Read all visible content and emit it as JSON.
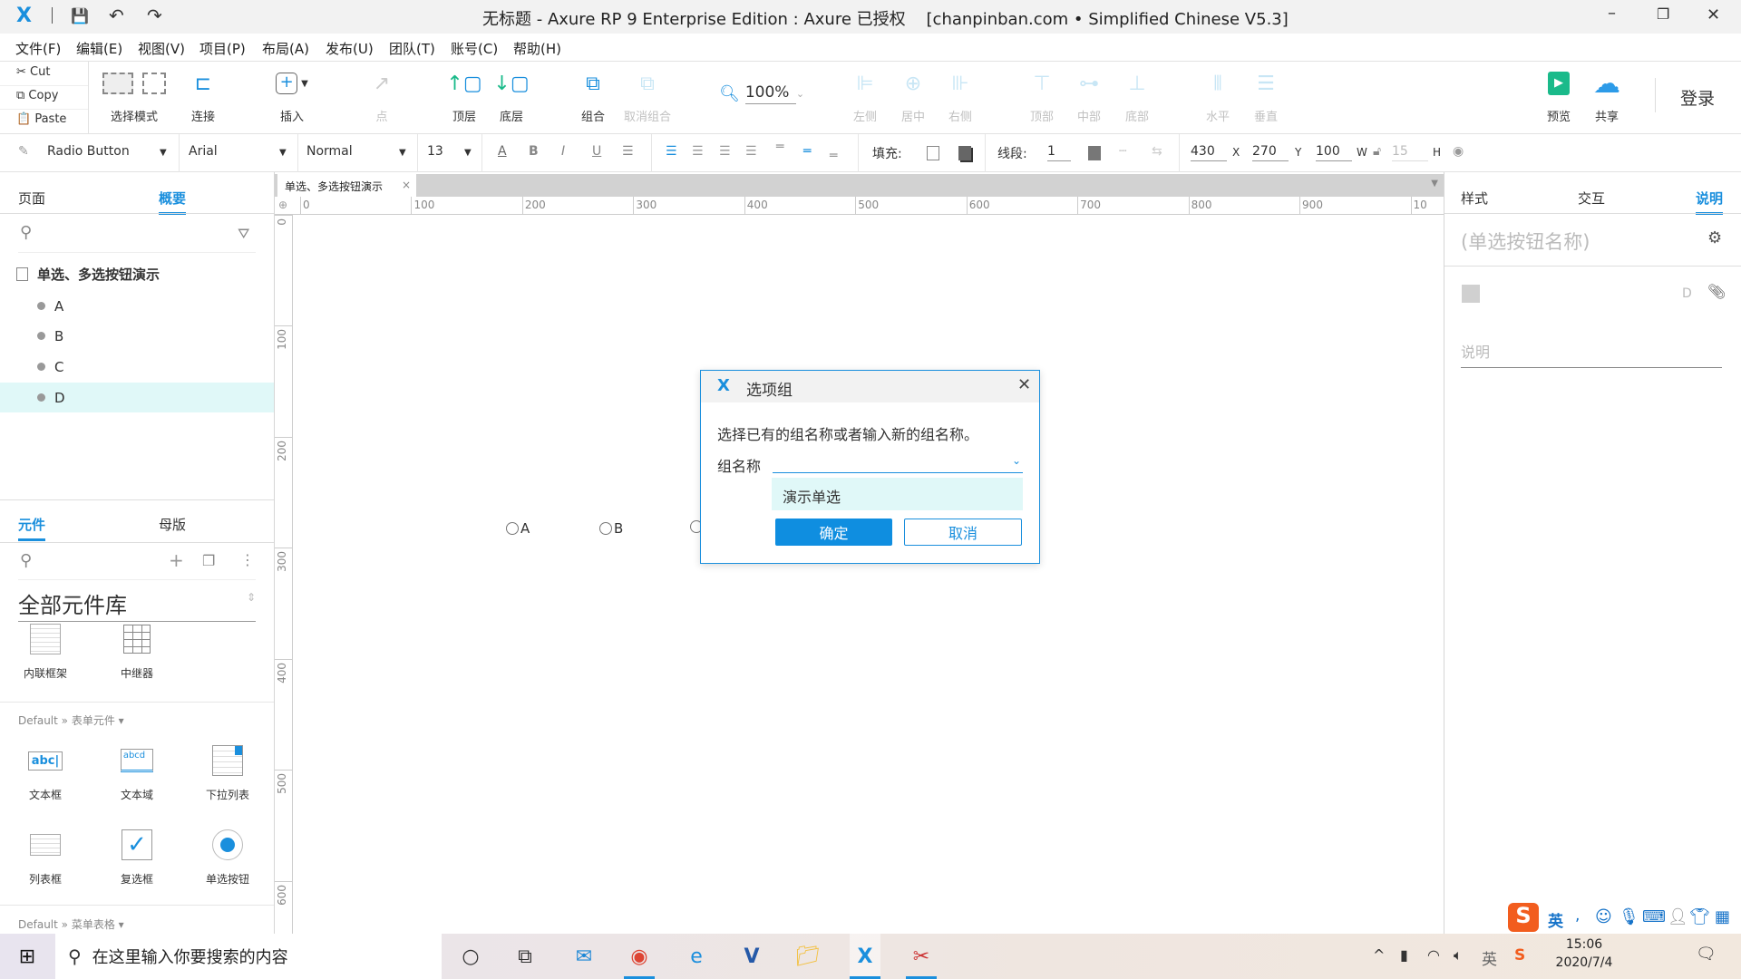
{
  "window": {
    "title": "无标题 - Axure RP 9 Enterprise Edition : Axure 已授权    [chanpinban.com • Simplified Chinese V5.3]"
  },
  "menu": [
    "文件(F)",
    "编辑(E)",
    "视图(V)",
    "项目(P)",
    "布局(A)",
    "发布(U)",
    "团队(T)",
    "账号(C)",
    "帮助(H)"
  ],
  "clipboard": {
    "cut": "Cut",
    "copy": "Copy",
    "paste": "Paste"
  },
  "toolbar": {
    "select_mode": "选择模式",
    "connect": "连接",
    "insert": "插入",
    "point": "点",
    "front": "顶层",
    "back": "底层",
    "group": "组合",
    "ungroup": "取消组合",
    "zoom": "100%",
    "left": "左侧",
    "center": "居中",
    "right": "右侧",
    "top": "顶部",
    "middle": "中部",
    "bottom": "底部",
    "horizontal": "水平",
    "vertical": "垂直",
    "preview": "预览",
    "share": "共享",
    "login": "登录"
  },
  "format": {
    "widget_type": "Radio Button",
    "font": "Arial",
    "style": "Normal",
    "size": "13",
    "fill_label": "填充:",
    "stroke_label": "线段:",
    "stroke_width": "1",
    "x": "430",
    "x_label": "X",
    "y": "270",
    "y_label": "Y",
    "w": "100",
    "w_label": "W",
    "h": "15",
    "h_label": "H"
  },
  "left_panel": {
    "tabs": [
      "页面",
      "概要"
    ],
    "active_tab": "概要",
    "page_name": "单选、多选按钮演示",
    "outline": [
      "A",
      "B",
      "C",
      "D"
    ],
    "selected": "D",
    "lib_tabs": [
      "元件",
      "母版"
    ],
    "library": "全部元件库",
    "lib_items": [
      "内联框架",
      "中继器"
    ],
    "section1": "Default » 表单元件 ▾",
    "form_items": [
      "文本框",
      "文本域",
      "下拉列表",
      "列表框",
      "复选框",
      "单选按钮"
    ],
    "section2": "Default » 菜单表格 ▾"
  },
  "canvas": {
    "tab": "单选、多选按钮演示",
    "ruler_h": [
      "0",
      "100",
      "200",
      "300",
      "400",
      "500",
      "600",
      "700",
      "800",
      "900",
      "10"
    ],
    "ruler_v": [
      "0",
      "100",
      "200",
      "300",
      "400",
      "500",
      "600"
    ],
    "radios": [
      "A",
      "B",
      ""
    ]
  },
  "dialog": {
    "title": "选项组",
    "message": "选择已有的组名称或者输入新的组名称。",
    "field_label": "组名称",
    "field_value": "",
    "option": "演示单选",
    "ok": "确定",
    "cancel": "取消"
  },
  "right_panel": {
    "tabs": [
      "样式",
      "交互",
      "说明"
    ],
    "active_tab": "说明",
    "name_placeholder": "(单选按钮名称)",
    "field_letter": "D",
    "notes_placeholder": "说明"
  },
  "taskbar": {
    "search_placeholder": "在这里输入你要搜索的内容",
    "ime": "英",
    "time": "15:06",
    "date": "2020/7/4"
  },
  "colors": {
    "accent": "#1a8fdd",
    "selection": "#e0f8f8",
    "preview": "#1aba8a"
  }
}
